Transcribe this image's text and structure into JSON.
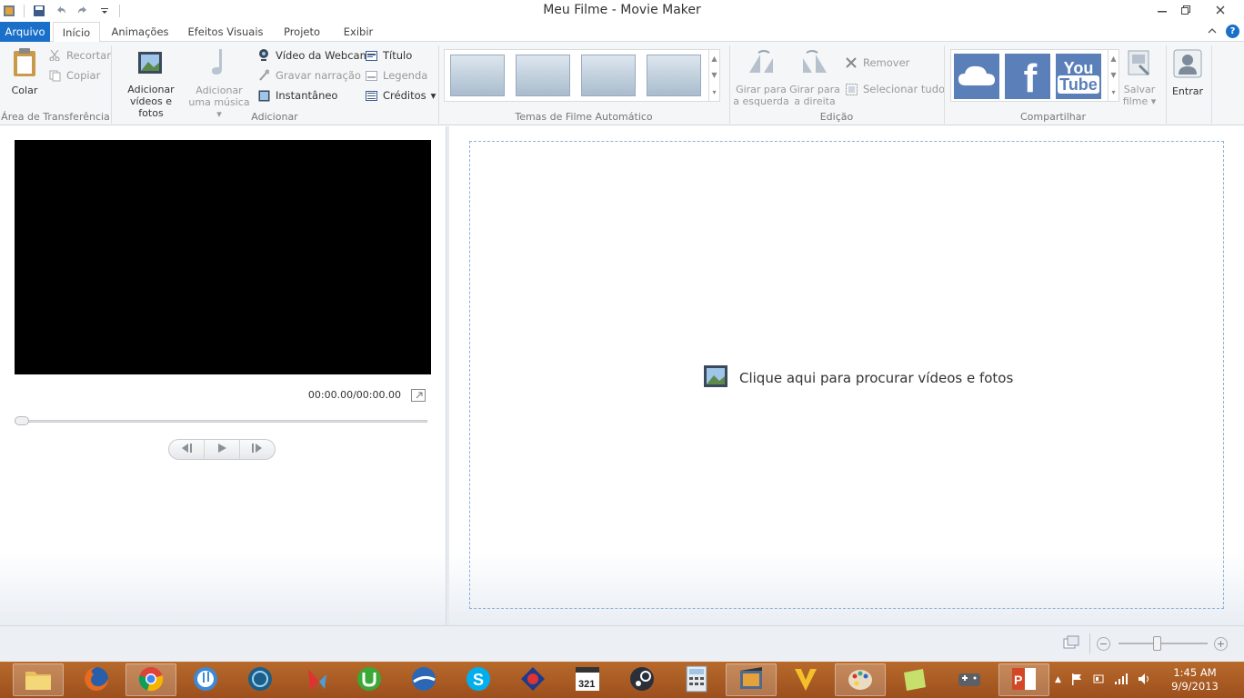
{
  "window": {
    "title": "Meu Filme - Movie Maker",
    "controls": [
      "minimize",
      "restore",
      "close"
    ]
  },
  "menu": {
    "file_tab": "Arquivo",
    "tabs": [
      "Início",
      "Animações",
      "Efeitos Visuais",
      "Projeto",
      "Exibir"
    ]
  },
  "ribbon": {
    "clipboard": {
      "label": "Área de Transferência",
      "paste": "Colar",
      "cut": "Recortar",
      "copy": "Copiar"
    },
    "add": {
      "label": "Adicionar",
      "add_videos_l1": "Adicionar",
      "add_videos_l2": "vídeos e fotos",
      "add_music_l1": "Adicionar",
      "add_music_l2": "uma música",
      "webcam": "Vídeo da Webcam",
      "narration": "Gravar narração",
      "snapshot": "Instantâneo",
      "title": "Título",
      "caption": "Legenda",
      "credits": "Créditos"
    },
    "themes": {
      "label": "Temas de Filme Automático"
    },
    "editing": {
      "label": "Edição",
      "rotate_left_l1": "Girar para",
      "rotate_left_l2": "a esquerda",
      "rotate_right_l1": "Girar para",
      "rotate_right_l2": "a direita",
      "remove": "Remover",
      "select_all": "Selecionar tudo"
    },
    "share": {
      "label": "Compartilhar",
      "save_l1": "Salvar",
      "save_l2": "filme"
    },
    "sign_in": "Entrar"
  },
  "preview": {
    "timecode": "00:00.00/00:00.00"
  },
  "storyboard": {
    "hint": "Clique aqui para procurar vídeos e fotos"
  },
  "taskbar": {
    "time": "1:45 AM",
    "date": "9/9/2013",
    "apps": [
      "file-explorer",
      "firefox",
      "chrome",
      "itunes",
      "app",
      "ccleaner",
      "utorrent",
      "google-earth",
      "skype",
      "app",
      "media-player-classic",
      "steam",
      "calculator",
      "movie-maker",
      "vectorian",
      "paint",
      "app",
      "game",
      "powerpoint"
    ]
  },
  "colors": {
    "file_tab": "#1a6fc9",
    "taskbar": "#a8591f",
    "storyboard_border": "#8bb1d9"
  }
}
